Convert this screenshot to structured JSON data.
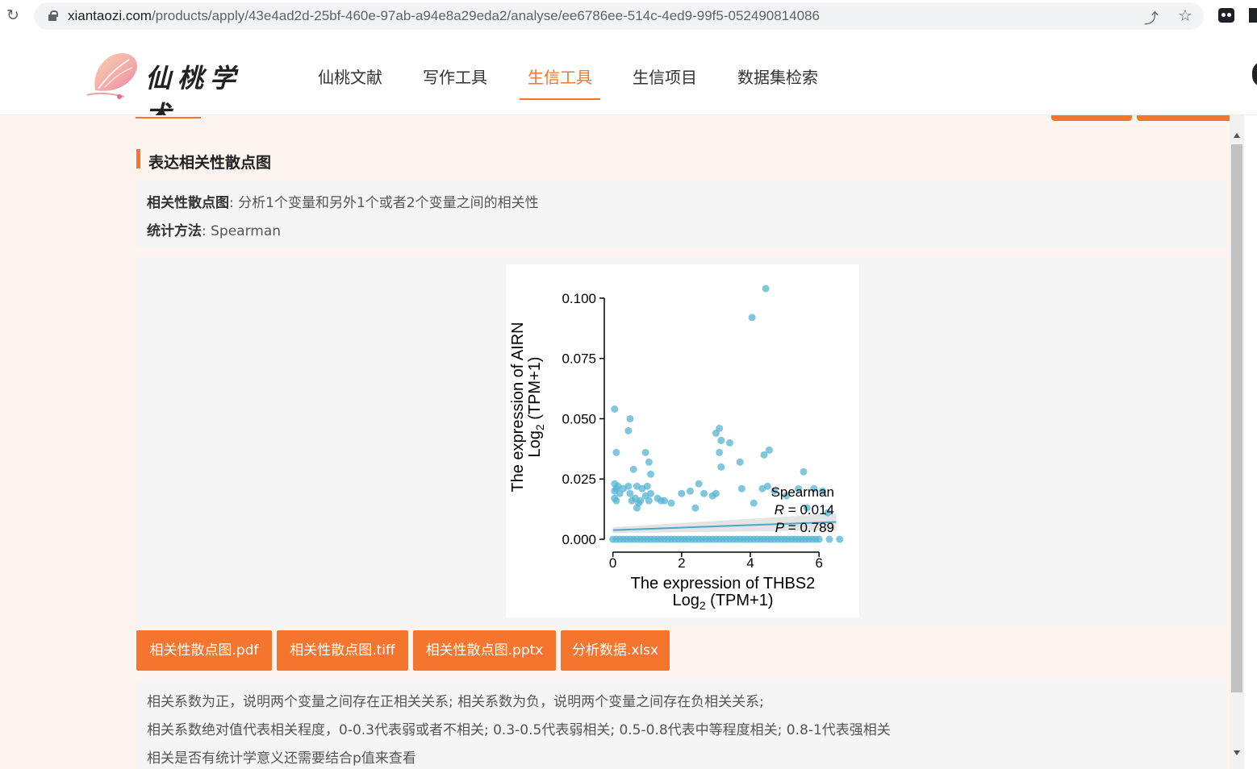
{
  "browser": {
    "url_host": "xiantaozi.com",
    "url_path": "/products/apply/43e4ad2d-25bf-460e-97ab-a94e8a29eda2/analyse/ee6786ee-514c-4ed9-99f5-052490814086"
  },
  "header": {
    "logo_text": "仙桃学术",
    "nav": [
      {
        "label": "仙桃文献"
      },
      {
        "label": "写作工具"
      },
      {
        "label": "生信工具"
      },
      {
        "label": "生信项目"
      },
      {
        "label": "数据集检索"
      }
    ],
    "active_nav": "生信工具",
    "accent_color": "#f5742e"
  },
  "section": {
    "title": "表达相关性散点图",
    "desc_label_1": "相关性散点图",
    "desc_text_1": ": 分析1个变量和另外1个或者2个变量之间的相关性",
    "desc_label_2": "统计方法",
    "desc_text_2": ": Spearman"
  },
  "downloads": [
    {
      "label": "相关性散点图.pdf"
    },
    {
      "label": "相关性散点图.tiff"
    },
    {
      "label": "相关性散点图.pptx"
    },
    {
      "label": "分析数据.xlsx"
    }
  ],
  "notes": [
    "相关系数为正，说明两个变量之间存在正相关关系; 相关系数为负，说明两个变量之间存在负相关关系;",
    "相关系数绝对值代表相关程度，0-0.3代表弱或者不相关; 0.3-0.5代表弱相关; 0.5-0.8代表中等程度相关; 0.8-1代表强相关",
    "相关是否有统计学意义还需要结合p值来查看"
  ],
  "chart_data": {
    "type": "scatter",
    "xlabel_line1": "The expression of THBS2",
    "xlabel_line2_pre": "Log",
    "xlabel_line2_sub": "2",
    "xlabel_line2_post": " (TPM+1)",
    "ylabel_line1": "The expression of AIRN",
    "ylabel_line2_pre": "Log",
    "ylabel_line2_sub": "2",
    "ylabel_line2_post": " (TPM+1)",
    "xlim": [
      -0.25,
      6.7
    ],
    "ylim": [
      -0.003,
      0.11
    ],
    "x_ticks": [
      "0",
      "2",
      "4",
      "6"
    ],
    "y_ticks": [
      "0.000",
      "0.025",
      "0.050",
      "0.075",
      "0.100"
    ],
    "annotation_method": "Spearman",
    "annotation_r_label": "R",
    "annotation_r_value": " = 0.014",
    "annotation_p_label": "P",
    "annotation_p_value": " = 0.789",
    "point_color": "#56b4d3",
    "regression": {
      "x0": 0.0,
      "y0": 0.0038,
      "x1": 6.5,
      "y1": 0.0072
    },
    "points": [
      [
        0.05,
        0.054
      ],
      [
        0.5,
        0.05
      ],
      [
        0.45,
        0.045
      ],
      [
        0.1,
        0.036
      ],
      [
        0.95,
        0.036
      ],
      [
        1.05,
        0.032
      ],
      [
        0.6,
        0.029
      ],
      [
        1.1,
        0.027
      ],
      [
        0.05,
        0.023
      ],
      [
        0.15,
        0.022
      ],
      [
        0.3,
        0.021
      ],
      [
        0.45,
        0.022
      ],
      [
        0.7,
        0.022
      ],
      [
        0.85,
        0.021
      ],
      [
        1.0,
        0.022
      ],
      [
        0.05,
        0.02
      ],
      [
        0.2,
        0.019
      ],
      [
        0.5,
        0.019
      ],
      [
        0.65,
        0.017
      ],
      [
        0.8,
        0.016
      ],
      [
        0.95,
        0.018
      ],
      [
        1.1,
        0.019
      ],
      [
        1.3,
        0.017
      ],
      [
        1.5,
        0.016
      ],
      [
        0.05,
        0.017
      ],
      [
        0.1,
        0.016
      ],
      [
        0.55,
        0.016
      ],
      [
        0.75,
        0.015
      ],
      [
        1.05,
        0.016
      ],
      [
        1.4,
        0.016
      ],
      [
        1.7,
        0.015
      ],
      [
        0.7,
        0.013
      ],
      [
        0.1,
        0.021
      ],
      [
        2.0,
        0.019
      ],
      [
        2.25,
        0.02
      ],
      [
        2.5,
        0.023
      ],
      [
        2.65,
        0.019
      ],
      [
        2.9,
        0.018
      ],
      [
        3.0,
        0.019
      ],
      [
        2.4,
        0.013
      ],
      [
        3.0,
        0.044
      ],
      [
        3.1,
        0.046
      ],
      [
        3.15,
        0.041
      ],
      [
        3.1,
        0.036
      ],
      [
        3.15,
        0.03
      ],
      [
        3.4,
        0.04
      ],
      [
        3.7,
        0.032
      ],
      [
        3.75,
        0.021
      ],
      [
        4.4,
        0.035
      ],
      [
        4.55,
        0.037
      ],
      [
        4.5,
        0.022
      ],
      [
        4.7,
        0.02
      ],
      [
        5.55,
        0.028
      ],
      [
        5.4,
        0.021
      ],
      [
        5.85,
        0.021
      ],
      [
        6.1,
        0.02
      ],
      [
        4.1,
        0.015
      ],
      [
        4.05,
        0.092
      ],
      [
        4.45,
        0.104
      ],
      [
        4.35,
        0.021
      ],
      [
        5.05,
        0.018
      ],
      [
        5.65,
        0.013
      ],
      [
        6.25,
        0.011
      ]
    ],
    "zero_points_x": [
      0.0,
      0.1,
      0.2,
      0.3,
      0.4,
      0.5,
      0.6,
      0.7,
      0.8,
      0.9,
      1.0,
      1.1,
      1.2,
      1.3,
      1.4,
      1.5,
      1.6,
      1.7,
      1.8,
      1.9,
      2.0,
      2.1,
      2.2,
      2.3,
      2.4,
      2.5,
      2.6,
      2.7,
      2.8,
      2.9,
      3.0,
      3.1,
      3.2,
      3.3,
      3.4,
      3.5,
      3.6,
      3.7,
      3.8,
      3.9,
      4.0,
      4.1,
      4.2,
      4.3,
      4.4,
      4.5,
      4.6,
      4.7,
      4.8,
      4.9,
      5.0,
      5.1,
      5.2,
      5.3,
      5.4,
      5.5,
      5.6,
      5.7,
      5.8,
      5.9,
      6.0,
      6.3,
      6.6
    ]
  }
}
